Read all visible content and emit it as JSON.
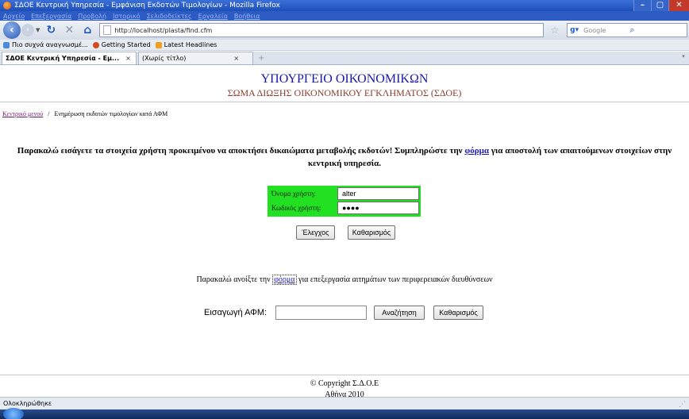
{
  "window": {
    "title": "ΣΔΟΕ  Κεντρική  Υπηρεσία - Εμφάνιση  Εκδοτών  Τιμολογίων - Mozilla Firefox",
    "buttons": {
      "minimize": "–",
      "maximize": "▢",
      "close": "✕"
    }
  },
  "menu": [
    "Αρχείο",
    "Επεξεργασία",
    "Προβολή",
    "Ιστορικό",
    "Σελιδοδείκτες",
    "Εργαλεία",
    "Βοήθεια"
  ],
  "nav": {
    "url": "http://localhost/plasta/find.cfm",
    "search_placeholder": "Google"
  },
  "bookmarks": [
    "Πιο συχνά αναγνωσμέ...",
    "Getting Started",
    "Latest Headlines"
  ],
  "tabs": [
    {
      "label": "ΣΔΟΕ  Κεντρική  Υπηρεσία - Εμ...",
      "close": "×"
    },
    {
      "label": "(Χωρίς τίτλο)",
      "close": "×"
    }
  ],
  "page": {
    "title": "ΥΠΟΥΡΓΕΙΟ ΟΙΚΟΝΟΜΙΚΩΝ",
    "subtitle": "ΣΩΜΑ ΔΙΩΞΗΣ ΟΙΚΟΝΟΜΙΚΟΥ ΕΓΚΛΗΜΑΤΟΣ (ΣΔΟΕ)",
    "breadcrumb": {
      "home": "Κεντρικό μενού",
      "separator": "/",
      "current": "Ενημέρωση εκδοτών τιμολογίων κατά ΑΦΜ"
    },
    "notice": {
      "before_link": "Παρακαλώ εισάγετε τα στοιχεία χρήστη προκειμένου να αποκτήσει δικαιώματα μεταβολής εκδοτών! Συμπληρώστε την",
      "link": "φόρμα",
      "after_link": "για αποστολή των απαιτούμενων στοιχείων στην κεντρική υπηρεσία."
    },
    "login": {
      "username_label": "Όνομα  χρήστη:",
      "username_value": "alter",
      "password_label": "Κωδικός  χρήστη:",
      "password_value": "●●●●",
      "check_button": "Έλεγχος",
      "clear_button": "Καθαρισμός"
    },
    "region": {
      "before_link": "Παρακαλώ ανοίξτε την",
      "link": "φόρμα",
      "after_link": "για επεξεργασία αιτημάτων των περιφερειακών διευθύνσεων"
    },
    "afm": {
      "label": "Εισαγωγή  ΑΦΜ:",
      "value": "",
      "search_button": "Αναζήτηση",
      "clear_button": "Καθαρισμός"
    },
    "footer": {
      "copyright": "© Copyright Σ.Δ.Ο.Ε",
      "city": "Αθήνα 2010"
    }
  },
  "status": "Ολοκληρώθηκε"
}
